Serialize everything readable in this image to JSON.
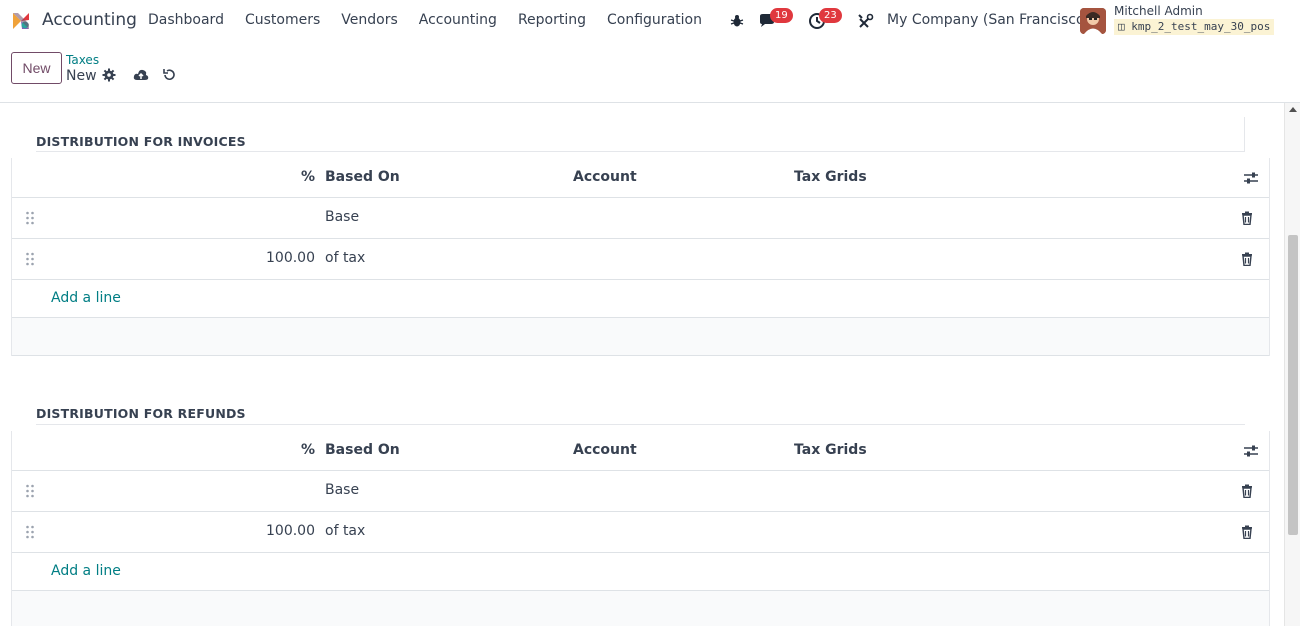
{
  "navbar": {
    "app_name": "Accounting",
    "menu": [
      "Dashboard",
      "Customers",
      "Vendors",
      "Accounting",
      "Reporting",
      "Configuration"
    ],
    "messages_count": "19",
    "activities_count": "23",
    "company": "My Company (San Francisco)",
    "user_name": "Mitchell Admin",
    "database": "kmp_2_test_may_30_pos"
  },
  "control_panel": {
    "new_button": "New",
    "breadcrumb_parent": "Taxes",
    "breadcrumb_current": "New"
  },
  "invoices": {
    "title": "DISTRIBUTION FOR INVOICES",
    "headers": {
      "percent": "%",
      "based_on": "Based On",
      "account": "Account",
      "tax_grids": "Tax Grids"
    },
    "rows": [
      {
        "percent": "",
        "based_on": "Base",
        "account": "",
        "tax_grids": ""
      },
      {
        "percent": "100.00",
        "based_on": "of tax",
        "account": "",
        "tax_grids": ""
      }
    ],
    "add_line": "Add a line"
  },
  "refunds": {
    "title": "DISTRIBUTION FOR REFUNDS",
    "headers": {
      "percent": "%",
      "based_on": "Based On",
      "account": "Account",
      "tax_grids": "Tax Grids"
    },
    "rows": [
      {
        "percent": "",
        "based_on": "Base",
        "account": "",
        "tax_grids": ""
      },
      {
        "percent": "100.00",
        "based_on": "of tax",
        "account": "",
        "tax_grids": ""
      }
    ],
    "add_line": "Add a line"
  },
  "colors": {
    "brand": "#714b67",
    "link": "#017e84",
    "badge": "#e0383e"
  },
  "icons": {
    "bug": "bug-icon",
    "messages": "chat-icon",
    "activities": "clock-icon",
    "settings": "tools-icon",
    "gear": "gear-icon",
    "save": "cloud-upload-icon",
    "discard": "undo-icon",
    "trash": "trash-icon",
    "handle": "drag-handle-icon",
    "optional_columns": "sliders-icon"
  }
}
